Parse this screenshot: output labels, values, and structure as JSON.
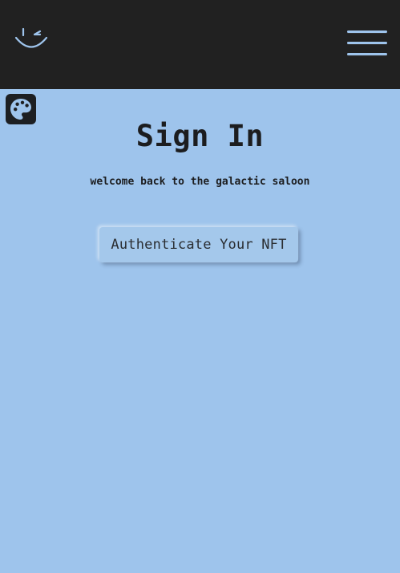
{
  "header": {
    "logo_icon": "winking-smiley-icon",
    "menu_icon": "hamburger-menu-icon",
    "accent_color": "#9ec4ec",
    "background_color": "#212121"
  },
  "theme_toggle": {
    "icon": "palette-icon"
  },
  "main": {
    "title": "Sign In",
    "subtitle": "welcome back to the galactic saloon",
    "auth_button_label": "Authenticate Your NFT",
    "background_color": "#9ec4ec"
  }
}
